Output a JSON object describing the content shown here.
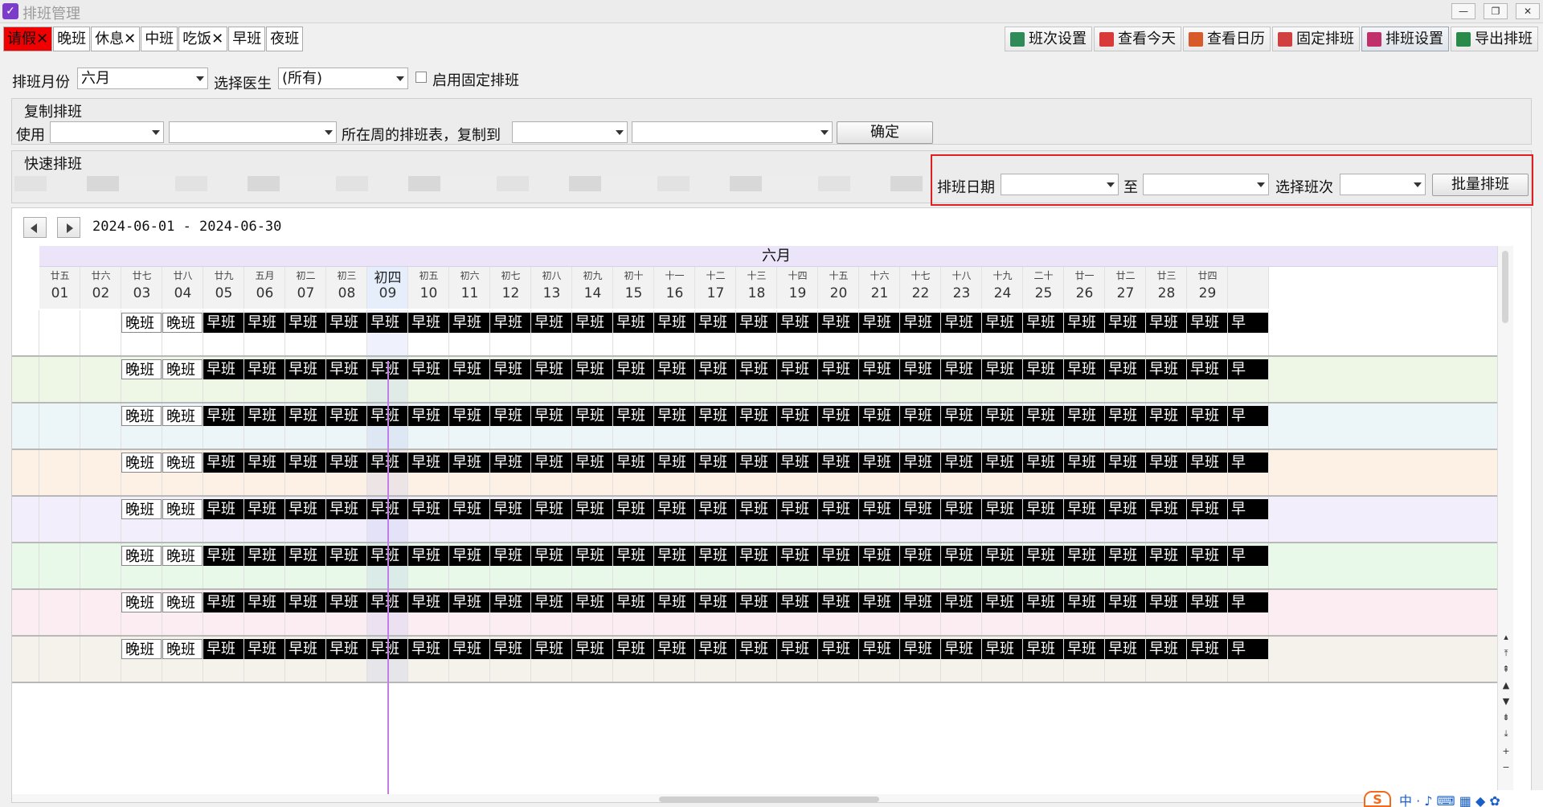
{
  "window": {
    "title": "排班管理"
  },
  "legend": [
    {
      "label": "请假✕",
      "kind": "leave"
    },
    {
      "label": "晚班",
      "kind": "normal"
    },
    {
      "label": "休息✕",
      "kind": "normal"
    },
    {
      "label": "中班",
      "kind": "normal"
    },
    {
      "label": "吃饭✕",
      "kind": "normal"
    },
    {
      "label": "早班",
      "kind": "normal"
    },
    {
      "label": "夜班",
      "kind": "normal"
    }
  ],
  "toolbar": [
    {
      "label": "班次设置",
      "icon": "shift-settings-icon",
      "color": "#2e8b57"
    },
    {
      "label": "查看今天",
      "icon": "today-icon",
      "color": "#d83a3a"
    },
    {
      "label": "查看日历",
      "icon": "calendar-31-icon",
      "color": "#d85a2a"
    },
    {
      "label": "固定排班",
      "icon": "fixed-schedule-icon",
      "color": "#d04040"
    },
    {
      "label": "排班设置",
      "icon": "schedule-settings-icon",
      "color": "#c0306a",
      "active": true
    },
    {
      "label": "导出排班",
      "icon": "export-excel-icon",
      "color": "#2a8a4a"
    }
  ],
  "filters": {
    "month_label": "排班月份",
    "month_value": "六月",
    "doctor_label": "选择医生",
    "doctor_value": "(所有)",
    "fixed_label": "启用固定排班"
  },
  "copy": {
    "title": "复制排班",
    "use_label": "使用",
    "mid_label": "所在周的排班表，复制到",
    "confirm": "确定"
  },
  "quick": {
    "title": "快速排班",
    "date_label": "排班日期",
    "to_label": "至",
    "shift_label": "选择班次",
    "batch": "批量排班"
  },
  "calendar": {
    "range": "2024-06-01 - 2024-06-30",
    "month": "六月",
    "today_index": 8,
    "days": [
      {
        "day": "01",
        "lunar": "廿五"
      },
      {
        "day": "02",
        "lunar": "廿六"
      },
      {
        "day": "03",
        "lunar": "廿七"
      },
      {
        "day": "04",
        "lunar": "廿八"
      },
      {
        "day": "05",
        "lunar": "廿九"
      },
      {
        "day": "06",
        "lunar": "五月"
      },
      {
        "day": "07",
        "lunar": "初二"
      },
      {
        "day": "08",
        "lunar": "初三"
      },
      {
        "day": "09",
        "lunar": "初四"
      },
      {
        "day": "10",
        "lunar": "初五"
      },
      {
        "day": "11",
        "lunar": "初六"
      },
      {
        "day": "12",
        "lunar": "初七"
      },
      {
        "day": "13",
        "lunar": "初八"
      },
      {
        "day": "14",
        "lunar": "初九"
      },
      {
        "day": "15",
        "lunar": "初十"
      },
      {
        "day": "16",
        "lunar": "十一"
      },
      {
        "day": "17",
        "lunar": "十二"
      },
      {
        "day": "18",
        "lunar": "十三"
      },
      {
        "day": "19",
        "lunar": "十四"
      },
      {
        "day": "20",
        "lunar": "十五"
      },
      {
        "day": "21",
        "lunar": "十六"
      },
      {
        "day": "22",
        "lunar": "十七"
      },
      {
        "day": "23",
        "lunar": "十八"
      },
      {
        "day": "24",
        "lunar": "十九"
      },
      {
        "day": "25",
        "lunar": "二十"
      },
      {
        "day": "26",
        "lunar": "廿一"
      },
      {
        "day": "27",
        "lunar": "廿二"
      },
      {
        "day": "28",
        "lunar": "廿三"
      },
      {
        "day": "29",
        "lunar": "廿四"
      }
    ],
    "rows": [
      {
        "bg": "#ffffff",
        "shifts": [
          "",
          "",
          "晚班",
          "晚班",
          "早班",
          "早班",
          "早班",
          "早班",
          "早班",
          "早班",
          "早班",
          "早班",
          "早班",
          "早班",
          "早班",
          "早班",
          "早班",
          "早班",
          "早班",
          "早班",
          "早班",
          "早班",
          "早班",
          "早班",
          "早班",
          "早班",
          "早班",
          "早班",
          "早班",
          "早"
        ]
      },
      {
        "bg": "#eef7e6",
        "shifts": [
          "",
          "",
          "晚班",
          "晚班",
          "早班",
          "早班",
          "早班",
          "早班",
          "早班",
          "早班",
          "早班",
          "早班",
          "早班",
          "早班",
          "早班",
          "早班",
          "早班",
          "早班",
          "早班",
          "早班",
          "早班",
          "早班",
          "早班",
          "早班",
          "早班",
          "早班",
          "早班",
          "早班",
          "早班",
          "早"
        ]
      },
      {
        "bg": "#ecf5f7",
        "shifts": [
          "",
          "",
          "晚班",
          "晚班",
          "早班",
          "早班",
          "早班",
          "早班",
          "早班",
          "早班",
          "早班",
          "早班",
          "早班",
          "早班",
          "早班",
          "早班",
          "早班",
          "早班",
          "早班",
          "早班",
          "早班",
          "早班",
          "早班",
          "早班",
          "早班",
          "早班",
          "早班",
          "早班",
          "早班",
          "早"
        ]
      },
      {
        "bg": "#fdf1e6",
        "shifts": [
          "",
          "",
          "晚班",
          "晚班",
          "早班",
          "早班",
          "早班",
          "早班",
          "早班",
          "早班",
          "早班",
          "早班",
          "早班",
          "早班",
          "早班",
          "早班",
          "早班",
          "早班",
          "早班",
          "早班",
          "早班",
          "早班",
          "早班",
          "早班",
          "早班",
          "早班",
          "早班",
          "早班",
          "早班",
          "早"
        ]
      },
      {
        "bg": "#f3eefb",
        "shifts": [
          "",
          "",
          "晚班",
          "晚班",
          "早班",
          "早班",
          "早班",
          "早班",
          "早班",
          "早班",
          "早班",
          "早班",
          "早班",
          "早班",
          "早班",
          "早班",
          "早班",
          "早班",
          "早班",
          "早班",
          "早班",
          "早班",
          "早班",
          "早班",
          "早班",
          "早班",
          "早班",
          "早班",
          "早班",
          "早"
        ]
      },
      {
        "bg": "#e9f9e9",
        "shifts": [
          "",
          "",
          "晚班",
          "晚班",
          "早班",
          "早班",
          "早班",
          "早班",
          "早班",
          "早班",
          "早班",
          "早班",
          "早班",
          "早班",
          "早班",
          "早班",
          "早班",
          "早班",
          "早班",
          "早班",
          "早班",
          "早班",
          "早班",
          "早班",
          "早班",
          "早班",
          "早班",
          "早班",
          "早班",
          "早"
        ]
      },
      {
        "bg": "#fcedf3",
        "shifts": [
          "",
          "",
          "晚班",
          "晚班",
          "早班",
          "早班",
          "早班",
          "早班",
          "早班",
          "早班",
          "早班",
          "早班",
          "早班",
          "早班",
          "早班",
          "早班",
          "早班",
          "早班",
          "早班",
          "早班",
          "早班",
          "早班",
          "早班",
          "早班",
          "早班",
          "早班",
          "早班",
          "早班",
          "早班",
          "早"
        ]
      },
      {
        "bg": "#f5f2eb",
        "shifts": [
          "",
          "",
          "晚班",
          "晚班",
          "早班",
          "早班",
          "早班",
          "早班",
          "早班",
          "早班",
          "早班",
          "早班",
          "早班",
          "早班",
          "早班",
          "早班",
          "早班",
          "早班",
          "早班",
          "早班",
          "早班",
          "早班",
          "早班",
          "早班",
          "早班",
          "早班",
          "早班",
          "早班",
          "早班",
          "早"
        ]
      }
    ]
  },
  "ime": {
    "glyphs": "中 · ♪ ⌨ ▦ ◆ ✿"
  }
}
